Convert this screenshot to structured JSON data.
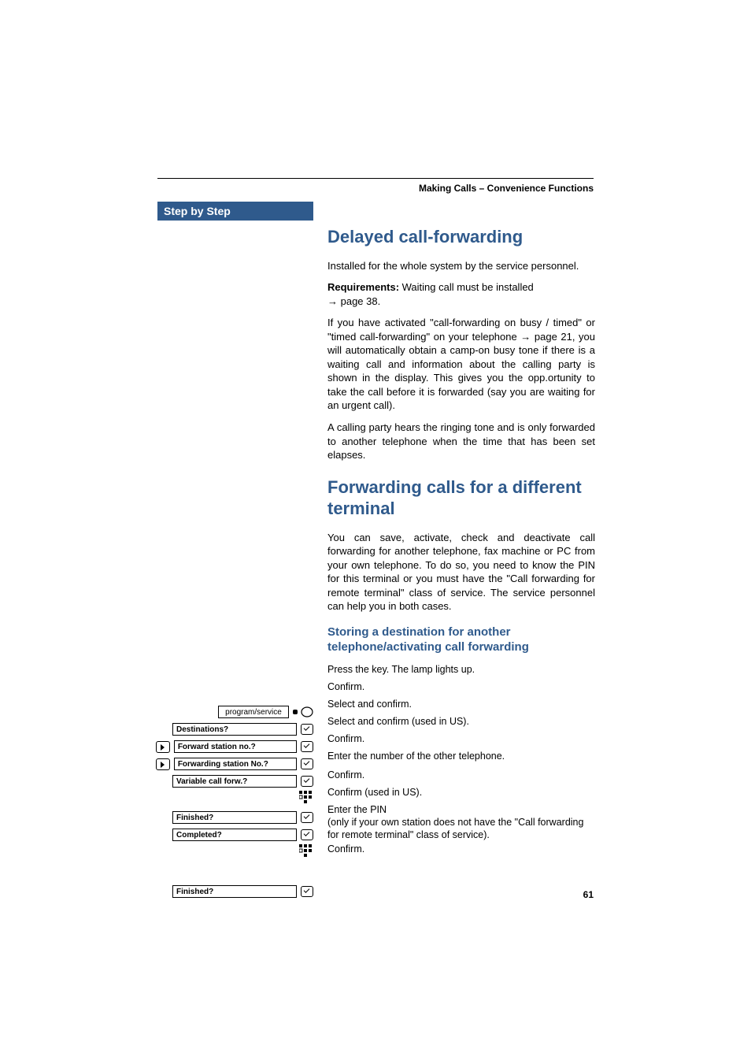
{
  "header": {
    "section": "Making Calls – Convenience Functions"
  },
  "sidebar": {
    "title": "Step by Step"
  },
  "content": {
    "h1a": "Delayed call-forwarding",
    "p1": "Installed for the whole system by the service personnel.",
    "req_label": "Requirements:",
    "req_text": " Waiting call must be installed ",
    "req_ref": "→ page 38.",
    "p2": "If you have activated \"call-forwarding on busy / timed\" or \"timed call-forwarding\" on your telephone → page 21, you will automatically obtain a camp-on busy tone if there is a waiting call and information about the calling party is shown in the display. This gives you the opp.ortunity to take the call before it is forwarded (say you are waiting for an urgent call).",
    "p3": "A calling party hears the ringing tone and is only forwarded to another telephone when the time that has been set elapses.",
    "h1b": "Forwarding calls for a different terminal",
    "p4": "You can save, activate, check and deactivate call forwarding for another telephone, fax machine or PC from your own telephone. To do so, you need to know the PIN for this terminal or you must have the \"Call forwarding for remote terminal\" class of service. The service personnel can help you in both cases.",
    "h2a": "Storing a destination for another telephone/activating call forwarding",
    "steps": {
      "s1": "Press the key. The lamp lights up.",
      "s2": "Confirm.",
      "s3": "Select and confirm.",
      "s4": "Select and confirm (used in US).",
      "s5": "Confirm.",
      "s6": "Enter the number of the other telephone.",
      "s7": "Confirm.",
      "s8": "Confirm (used in US).",
      "s9": "Enter the PIN",
      "s9b": "(only if your own station does not have the \"Call forwarding for remote terminal\" class of service).",
      "s10": "Confirm."
    }
  },
  "left_items": {
    "program": "program/service",
    "dest": "Destinations?",
    "fwd_no": "Forward station no.?",
    "fwd_No": "Forwarding station No.?",
    "var": "Variable call forw.?",
    "fin1": "Finished?",
    "comp": "Completed?",
    "fin2": "Finished?"
  },
  "page_number": "61"
}
